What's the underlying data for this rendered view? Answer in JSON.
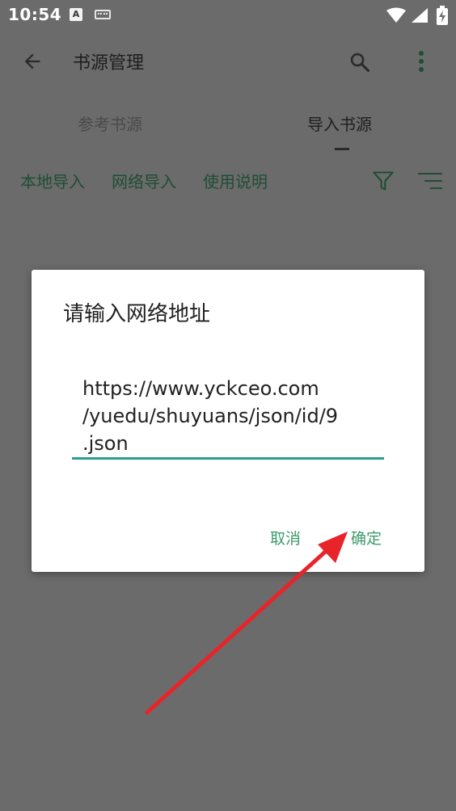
{
  "status_bar": {
    "time": "10:54",
    "a_icon": "A"
  },
  "toolbar": {
    "title": "书源管理"
  },
  "tabs": [
    {
      "label": "参考书源"
    },
    {
      "label": "导入书源"
    }
  ],
  "actions": {
    "local_import": "本地导入",
    "network_import": "网络导入",
    "instructions": "使用说明"
  },
  "dialog": {
    "title": "请输入网络地址",
    "url_value": "https://www.yckceo.com\n/yuedu/shuyuans/json/id/9\n.json",
    "cancel_label": "取消",
    "confirm_label": "确定"
  },
  "colors": {
    "accent": "#3d9a6c",
    "underline": "#2a9d8f",
    "annotation_arrow": "#e8242b"
  }
}
